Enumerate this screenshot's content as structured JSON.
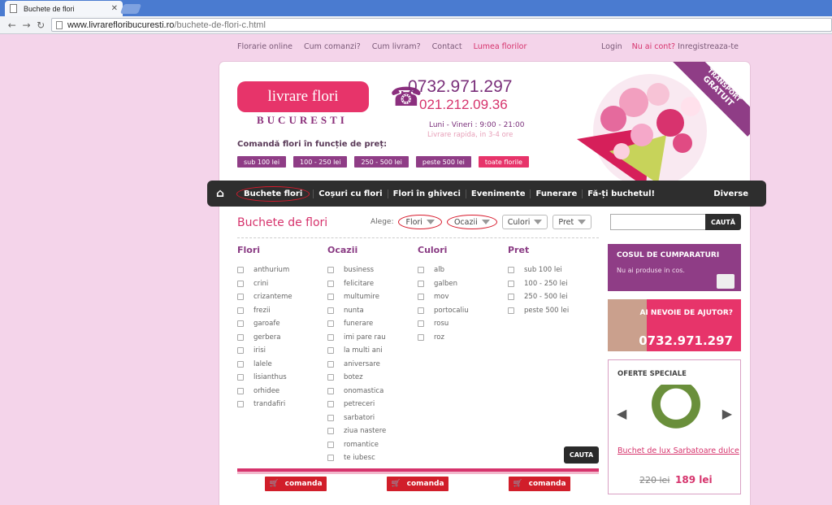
{
  "browser": {
    "tab_title": "Buchete de flori",
    "url_host": "www.livrarefloribucuresti.ro",
    "url_path": "/buchete-de-flori-c.html"
  },
  "topnav": [
    "Florarie online",
    "Cum comanzi?",
    "Cum livram?",
    "Contact",
    "Lumea florilor"
  ],
  "account": {
    "login": "Login",
    "no_account": "Nu ai cont?",
    "register": "Inregistreaza-te"
  },
  "header": {
    "logo_text": "livrare flori",
    "logo_sub": "BUCURESTI",
    "phone_main": "0732.971.297",
    "phone_alt": "021.212.09.36",
    "hours": "Luni - Vineri : 9:00 - 21:00",
    "fast": "Livrare rapida, in 3-4 ore",
    "price_title": "Comandă flori în funcție de preț:",
    "price_buttons": [
      "sub 100 lei",
      "100 - 250 lei",
      "250 - 500 lei",
      "peste 500 lei",
      "toate florile"
    ],
    "ribbon_top": "TRANSPORT",
    "ribbon_bottom": "GRATUIT"
  },
  "mainnav": {
    "items": [
      "Buchete flori",
      "Coșuri cu flori",
      "Flori în ghiveci",
      "Evenimente",
      "Funerare",
      "Fă-ți buchetul!"
    ],
    "right": "Diverse"
  },
  "main": {
    "title": "Buchete de flori",
    "filter_label": "Alege:",
    "filters": [
      "Flori",
      "Ocazii",
      "Culori",
      "Pret"
    ],
    "search_button": "CAUTĂ",
    "columns": [
      {
        "title": "Flori",
        "items": [
          "anthurium",
          "crini",
          "crizanteme",
          "frezii",
          "garoafe",
          "gerbera",
          "irisi",
          "lalele",
          "lisianthus",
          "orhidee",
          "trandafiri"
        ]
      },
      {
        "title": "Ocazii",
        "items": [
          "business",
          "felicitare",
          "multumire",
          "nunta",
          "funerare",
          "imi pare rau",
          "la multi ani",
          "aniversare",
          "botez",
          "onomastica",
          "petreceri",
          "sarbatori",
          "ziua nastere",
          "romantice",
          "te iubesc"
        ]
      },
      {
        "title": "Culori",
        "items": [
          "alb",
          "galben",
          "mov",
          "portocaliu",
          "rosu",
          "roz"
        ]
      },
      {
        "title": "Pret",
        "items": [
          "sub 100 lei",
          "100 - 250 lei",
          "250 - 500 lei",
          "peste 500 lei"
        ]
      }
    ],
    "cauta_button": "CAUTA",
    "comanda_label": "comanda"
  },
  "sidebar": {
    "cart_title": "COSUL DE CUMPARATURI",
    "cart_empty": "Nu ai produse in cos.",
    "help_question": "AI NEVOIE DE AJUTOR?",
    "help_phone": "0732.971.297",
    "offers_title": "OFERTE SPECIALE",
    "offer_name": "Buchet de lux Sarbatoare dulce",
    "old_price": "220 lei",
    "new_price": "189 lei"
  }
}
